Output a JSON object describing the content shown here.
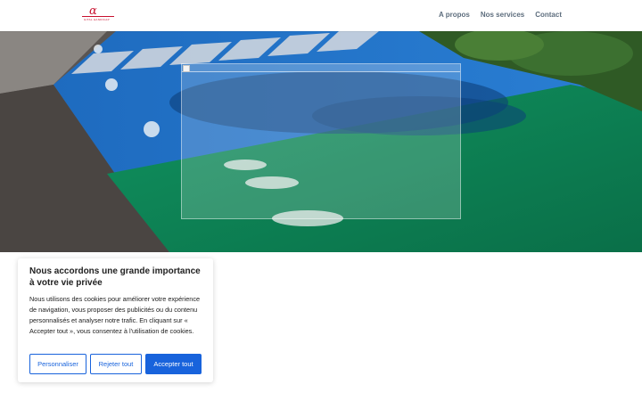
{
  "header": {
    "logo": {
      "glyph": "α",
      "subtitle": "GITAL HANDICAP"
    },
    "nav": [
      {
        "label": "A propos"
      },
      {
        "label": "Nos services"
      },
      {
        "label": "Contact"
      }
    ]
  },
  "hero": {
    "overlay_icon": "broken-image-icon"
  },
  "cookie": {
    "title": "Nous accordons une grande importance à votre vie privée",
    "text": "Nous utilisons des cookies pour améliorer votre expérience de navigation, vous proposer des publicités ou du contenu personnalisés et analyser notre trafic. En cliquant sur « Accepter tout », vous consentez à l'utilisation de cookies.",
    "buttons": {
      "customize": "Personnaliser",
      "reject": "Rejeter tout",
      "accept": "Accepter tout"
    }
  },
  "colors": {
    "accent": "#1863dc",
    "logo": "#c8102e",
    "nav_text": "#5e6e7e",
    "parking_blue": "#1f6fc4",
    "parking_green": "#0f8a5c",
    "asphalt": "#4a4542"
  }
}
